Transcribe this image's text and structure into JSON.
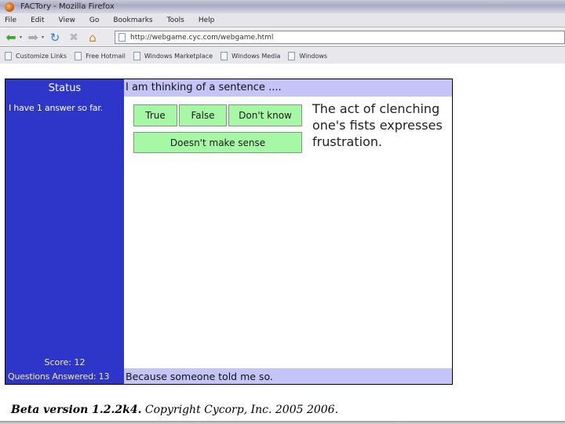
{
  "browser": {
    "window_title": "FACTory - Mozilla Firefox",
    "menu": [
      "File",
      "Edit",
      "View",
      "Go",
      "Bookmarks",
      "Tools",
      "Help"
    ],
    "url": "http://webgame.cyc.com/webgame.html",
    "bookmarks": [
      "Customize Links",
      "Free Hotmail",
      "Windows Marketplace",
      "Windows Media",
      "Windows"
    ],
    "icons": {
      "back": "back-arrow-icon",
      "forward": "forward-arrow-icon",
      "reload": "reload-icon",
      "stop": "stop-icon",
      "home": "home-icon"
    }
  },
  "sidebar": {
    "title": "Status",
    "answers_text": "I have 1 answer so far.",
    "score": "Score: 12",
    "questions_answered": "Questions Answered: 13"
  },
  "main": {
    "prompt": "I am thinking of a sentence ....",
    "sentence": "The act of clenching one's fists expresses frustration.",
    "buttons": {
      "true": "True",
      "false": "False",
      "dont_know": "Don't know",
      "doesnt_make_sense": "Doesn't make sense"
    },
    "reason": "Because someone told me so."
  },
  "footer": {
    "version": "Beta version 1.2.2k4.",
    "copyright": "Copyright Cycorp, Inc. 2005    2006."
  },
  "colors": {
    "sidebar_bg": "#2d36c9",
    "band_bg": "#c4c4f8",
    "button_bg": "#a6f7a6",
    "stat_text": "#f5ea9a"
  }
}
